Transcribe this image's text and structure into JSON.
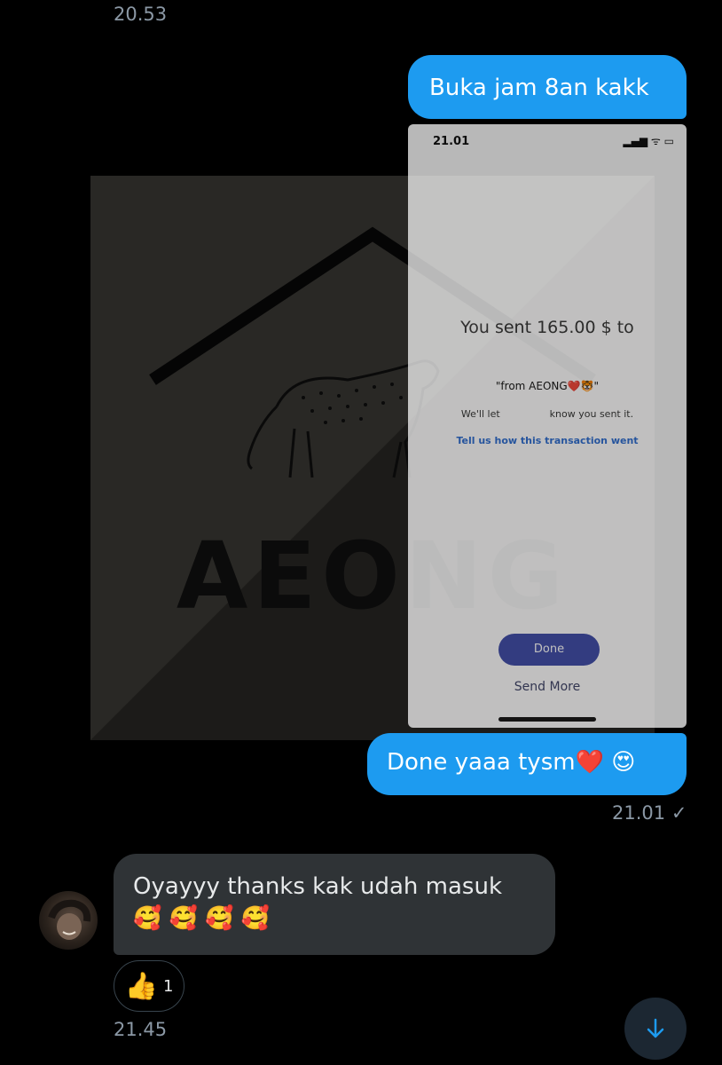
{
  "timestamps": {
    "top": "20.53",
    "sent": "21.01",
    "bottom": "21.45"
  },
  "messages": {
    "out1": "Buka jam 8an kakk",
    "out2": "Done yaaa tysm❤️ 😍",
    "in1_line1": "Oyayyy thanks kak udah masuk",
    "in1_line2": "🥰 🥰 🥰 🥰"
  },
  "read_receipt": "✓",
  "watermark": {
    "word": "AEONG"
  },
  "phone": {
    "time": "21.01",
    "icons": "▂▄▆ ᯤ ▭",
    "sent_text": "You sent 165.00 $ to",
    "note": "\"from AEONG❤️🐯\"",
    "we_let_1": "We'll let",
    "we_let_2": "know you sent it.",
    "feedback_link": "Tell us how this transaction went",
    "done_label": "Done",
    "send_more_label": "Send More"
  },
  "reaction": {
    "emoji": "👍",
    "count": "1"
  },
  "colors": {
    "bubble_out": "#1d9bf0",
    "bubble_in": "#2f3336",
    "background": "#000000"
  },
  "icons": {
    "scroll": "arrow-down-icon"
  }
}
